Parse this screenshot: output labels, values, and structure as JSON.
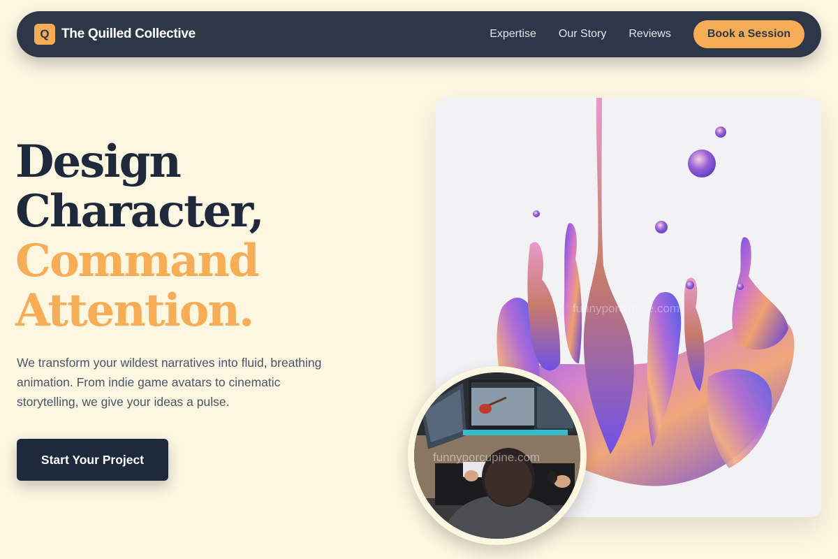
{
  "brand": {
    "logo_letter": "Q",
    "name": "The Quilled Collective"
  },
  "nav": {
    "links": [
      "Expertise",
      "Our Story",
      "Reviews"
    ],
    "cta_label": "Book a Session"
  },
  "hero": {
    "headline_dark": [
      "Design",
      "Character,"
    ],
    "headline_accent": [
      "Command",
      "Attention."
    ],
    "subtext": "We transform your wildest narratives into fluid, breathing animation. From indie game avatars to cinematic storytelling, we give your ideas a pulse.",
    "button_label": "Start Your Project"
  },
  "watermark": "funnyporcupine.com",
  "colors": {
    "background": "#fdf6e1",
    "navbar": "#2d3748",
    "accent": "#f6ad55",
    "headline_dark": "#1e293b",
    "body_text": "#4a5568"
  }
}
